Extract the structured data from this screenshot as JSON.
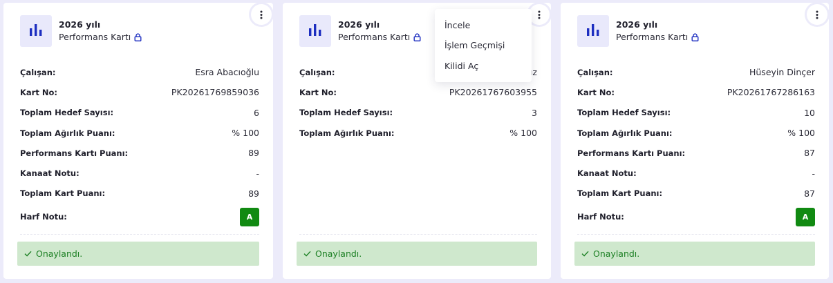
{
  "colors": {
    "page_bg": "#ecebfa",
    "card_bg": "#ffffff",
    "icon_tile_bg": "#e9e9fb",
    "brand_blue": "#1d2ec0",
    "grade_green": "#118a12",
    "status_bg": "#cfe8cd",
    "status_text": "#1b7f22"
  },
  "icons": {
    "menu": "kebab-vertical",
    "card": "bar-chart",
    "locked": "lock",
    "approved": "check"
  },
  "dropdown": {
    "items": [
      {
        "label": "İncele"
      },
      {
        "label": "İşlem Geçmişi"
      },
      {
        "label": "Kilidi Aç"
      }
    ]
  },
  "cards": [
    {
      "year": "2026 yılı",
      "subtitle": "Performans Kartı",
      "rows": {
        "employee": {
          "label": "Çalışan:",
          "value": "Esra Abacıoğlu"
        },
        "card_no": {
          "label": "Kart No:",
          "value": "PK20261769859036"
        },
        "goal_count": {
          "label": "Toplam Hedef Sayısı:",
          "value": "6"
        },
        "weight_score": {
          "label": "Toplam Ağırlık Puanı:",
          "value": "% 100"
        },
        "perf_score": {
          "label": "Performans Kartı Puanı:",
          "value": "89"
        },
        "opinion": {
          "label": "Kanaat Notu:",
          "value": "-"
        },
        "total_score": {
          "label": "Toplam Kart Puanı:",
          "value": "89"
        },
        "letter_grade": {
          "label": "Harf Notu:",
          "value": "A"
        }
      },
      "status": "Onaylandı."
    },
    {
      "year": "2026 yılı",
      "subtitle": "Performans Kartı",
      "rows": {
        "employee": {
          "label": "Çalışan:",
          "value": "ız"
        },
        "card_no": {
          "label": "Kart No:",
          "value": "PK20261767603955"
        },
        "goal_count": {
          "label": "Toplam Hedef Sayısı:",
          "value": "3"
        },
        "weight_score": {
          "label": "Toplam Ağırlık Puanı:",
          "value": "% 100"
        }
      },
      "status": "Onaylandı."
    },
    {
      "year": "2026 yılı",
      "subtitle": "Performans Kartı",
      "rows": {
        "employee": {
          "label": "Çalışan:",
          "value": "Hüseyin Dinçer"
        },
        "card_no": {
          "label": "Kart No:",
          "value": "PK20261767286163"
        },
        "goal_count": {
          "label": "Toplam Hedef Sayısı:",
          "value": "10"
        },
        "weight_score": {
          "label": "Toplam Ağırlık Puanı:",
          "value": "% 100"
        },
        "perf_score": {
          "label": "Performans Kartı Puanı:",
          "value": "87"
        },
        "opinion": {
          "label": "Kanaat Notu:",
          "value": "-"
        },
        "total_score": {
          "label": "Toplam Kart Puanı:",
          "value": "87"
        },
        "letter_grade": {
          "label": "Harf Notu:",
          "value": "A"
        }
      },
      "status": "Onaylandı."
    }
  ]
}
